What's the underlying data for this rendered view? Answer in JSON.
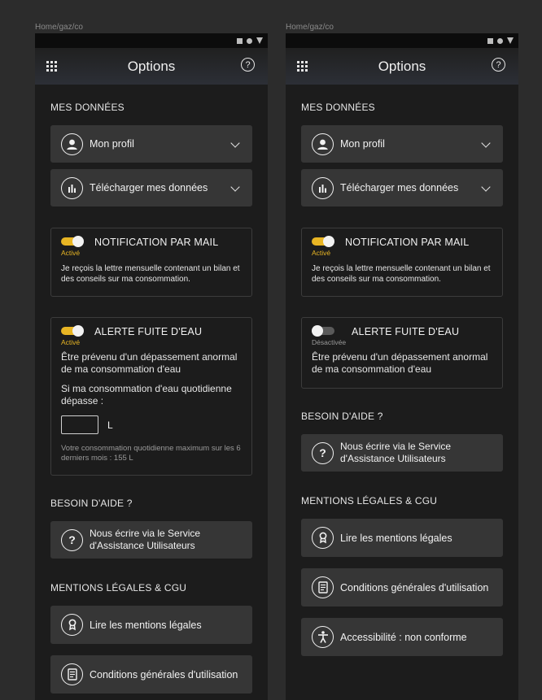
{
  "breadcrumb": "Home/gaz/co",
  "app_title": "Options",
  "sections": {
    "data_title": "MES DONNÉES",
    "help_title": "BESOIN D'AIDE ?",
    "legal_title": "MENTIONS LÉGALES & CGU"
  },
  "buttons": {
    "profile": "Mon profil",
    "download": "Télécharger mes données",
    "contact": "Nous écrire via le Service d'Assistance Utilisateurs",
    "legal": "Lire les mentions légales",
    "cgu": "Conditions générales d'utilisation",
    "accessibility": "Accessibilité : non conforme"
  },
  "mail_notification": {
    "label": "NOTIFICATION PAR MAIL",
    "state": "Activé",
    "enabled": true,
    "description": "Je reçois la lettre mensuelle contenant un bilan et des conseils sur ma consommation."
  },
  "leak_alert": {
    "label": "ALERTE FUITE D'EAU",
    "state_on": "Activé",
    "state_off": "Désactivée",
    "description": "Être prévenu d'un dépassement anormal de ma consommation d'eau",
    "threshold_question": "Si ma consommation d'eau quotidienne dépasse :",
    "threshold_value": "",
    "unit": "L",
    "hint": "Votre consommation quotidienne maximum sur les 6 derniers mois : 155 L"
  },
  "colors": {
    "accent": "#e8b524",
    "background": "#1c1c1c",
    "card": "#363636"
  },
  "icons": {
    "menu": "grid-menu-icon",
    "help": "help-circle-icon",
    "profile": "user-icon",
    "download": "bar-chart-icon",
    "contact": "question-icon",
    "legal": "award-icon",
    "cgu": "document-icon",
    "accessibility": "accessibility-icon"
  }
}
